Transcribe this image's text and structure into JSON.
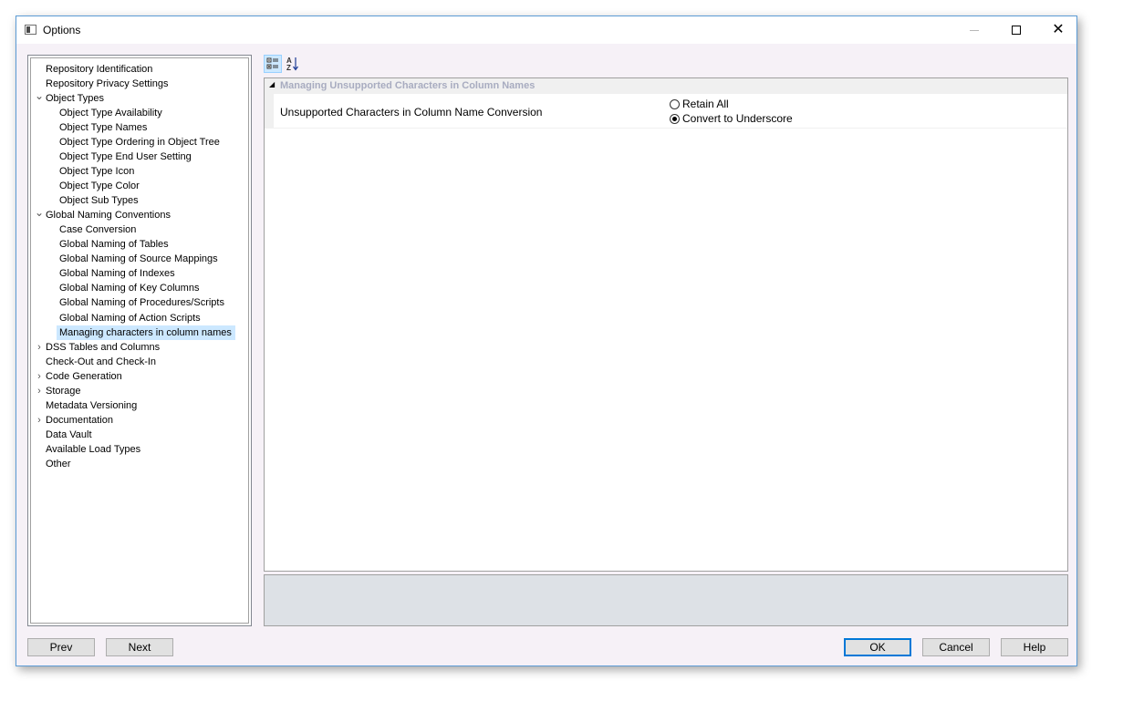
{
  "window": {
    "title": "Options"
  },
  "tree": {
    "items": [
      {
        "label": "Repository Identification",
        "level": 0,
        "expander": ""
      },
      {
        "label": "Repository Privacy Settings",
        "level": 0,
        "expander": ""
      },
      {
        "label": "Object Types",
        "level": 0,
        "expander": "expanded"
      },
      {
        "label": "Object Type Availability",
        "level": 1,
        "expander": ""
      },
      {
        "label": "Object Type Names",
        "level": 1,
        "expander": ""
      },
      {
        "label": "Object Type Ordering in Object Tree",
        "level": 1,
        "expander": ""
      },
      {
        "label": "Object Type End User Setting",
        "level": 1,
        "expander": ""
      },
      {
        "label": "Object Type Icon",
        "level": 1,
        "expander": ""
      },
      {
        "label": "Object Type Color",
        "level": 1,
        "expander": ""
      },
      {
        "label": "Object Sub Types",
        "level": 1,
        "expander": ""
      },
      {
        "label": "Global Naming Conventions",
        "level": 0,
        "expander": "expanded"
      },
      {
        "label": "Case Conversion",
        "level": 1,
        "expander": ""
      },
      {
        "label": "Global Naming of Tables",
        "level": 1,
        "expander": ""
      },
      {
        "label": "Global Naming of Source Mappings",
        "level": 1,
        "expander": ""
      },
      {
        "label": "Global Naming of Indexes",
        "level": 1,
        "expander": ""
      },
      {
        "label": "Global Naming of Key Columns",
        "level": 1,
        "expander": ""
      },
      {
        "label": "Global Naming of Procedures/Scripts",
        "level": 1,
        "expander": ""
      },
      {
        "label": "Global Naming of Action Scripts",
        "level": 1,
        "expander": ""
      },
      {
        "label": "Managing characters in column names",
        "level": 1,
        "expander": "",
        "selected": true
      },
      {
        "label": "DSS Tables and Columns",
        "level": 0,
        "expander": "collapsed"
      },
      {
        "label": "Check-Out and Check-In",
        "level": 0,
        "expander": ""
      },
      {
        "label": "Code Generation",
        "level": 0,
        "expander": "collapsed"
      },
      {
        "label": "Storage",
        "level": 0,
        "expander": "collapsed"
      },
      {
        "label": "Metadata Versioning",
        "level": 0,
        "expander": ""
      },
      {
        "label": "Documentation",
        "level": 0,
        "expander": "collapsed"
      },
      {
        "label": "Data Vault",
        "level": 0,
        "expander": ""
      },
      {
        "label": "Available Load Types",
        "level": 0,
        "expander": ""
      },
      {
        "label": "Other",
        "level": 0,
        "expander": ""
      }
    ]
  },
  "toolbar": {
    "categorized_icon": "categorized-view-icon",
    "alphabetical_icon": "sort-alphabetical-icon",
    "categorized_active": true
  },
  "property_grid": {
    "category": "Managing Unsupported Characters in Column Names",
    "property_name": "Unsupported Characters in Column Name Conversion",
    "options": [
      {
        "label": "Retain All",
        "checked": false
      },
      {
        "label": "Convert to Underscore",
        "checked": true
      }
    ]
  },
  "buttons": {
    "prev": "Prev",
    "next": "Next",
    "ok": "OK",
    "cancel": "Cancel",
    "help": "Help"
  },
  "colors": {
    "selection": "#cce8ff",
    "window_border": "#5b9bd5",
    "default_button_border": "#0078d7",
    "category_text": "#a8acc0"
  }
}
